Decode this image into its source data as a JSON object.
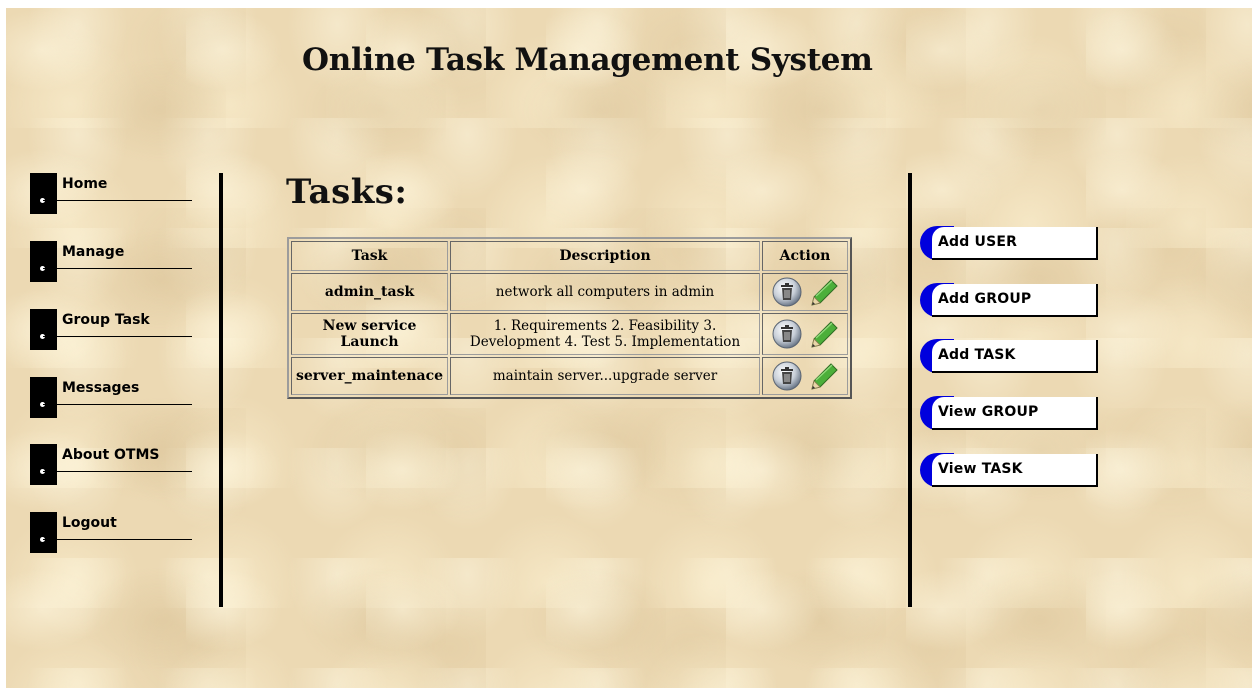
{
  "site": {
    "title": "Online Task Management System"
  },
  "nav": {
    "items": [
      {
        "label": "Home"
      },
      {
        "label": "Manage"
      },
      {
        "label": "Group Task"
      },
      {
        "label": "Messages"
      },
      {
        "label": "About OTMS"
      },
      {
        "label": "Logout"
      }
    ]
  },
  "main": {
    "heading": "Tasks:",
    "table": {
      "headers": {
        "task": "Task",
        "description": "Description",
        "action": "Action"
      },
      "rows": [
        {
          "task": "admin_task",
          "description": "network all computers in admin"
        },
        {
          "task": "New service Launch",
          "description": "1. Requirements 2. Feasibility 3. Development 4. Test 5. Implementation"
        },
        {
          "task": "server_maintenace",
          "description": "maintain server...upgrade server"
        }
      ],
      "action_icons": [
        "trash-icon",
        "pencil-icon"
      ]
    }
  },
  "actions": {
    "buttons": [
      {
        "label": "Add USER"
      },
      {
        "label": "Add GROUP"
      },
      {
        "label": "Add TASK"
      },
      {
        "label": "View GROUP"
      },
      {
        "label": "View TASK"
      }
    ]
  },
  "colors": {
    "accent_blue": "#0000dd",
    "background": "#ecd9b3"
  }
}
